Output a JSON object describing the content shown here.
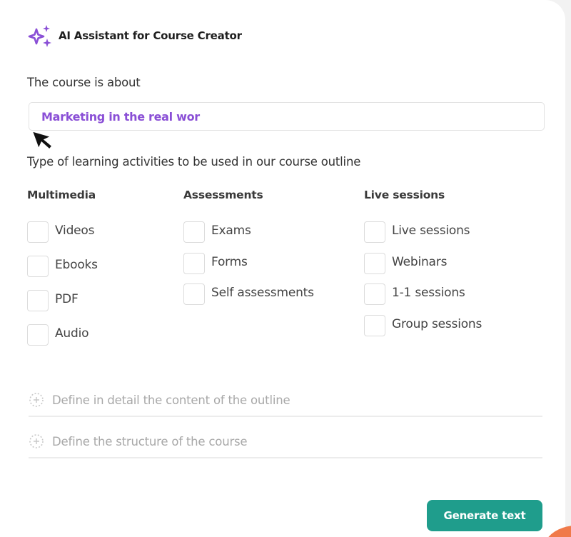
{
  "header": {
    "icon": "sparkles-icon",
    "title": "AI Assistant for Course Creator",
    "accent_color": "#8a4fd6"
  },
  "topic": {
    "label": "The course is about",
    "value": "Marketing in the real wor"
  },
  "activities": {
    "label": "Type of learning activities to be used in our course outline",
    "groups": [
      {
        "title": "Multimedia",
        "options": [
          {
            "label": "Videos",
            "checked": false
          },
          {
            "label": "Ebooks",
            "checked": false
          },
          {
            "label": "PDF",
            "checked": false
          },
          {
            "label": "Audio",
            "checked": false
          }
        ]
      },
      {
        "title": "Assessments",
        "options": [
          {
            "label": "Exams",
            "checked": false
          },
          {
            "label": "Forms",
            "checked": false
          },
          {
            "label": "Self assessments",
            "checked": false
          }
        ]
      },
      {
        "title": "Live sessions",
        "options": [
          {
            "label": "Live sessions",
            "checked": false
          },
          {
            "label": "Webinars",
            "checked": false
          },
          {
            "label": "1-1 sessions",
            "checked": false
          },
          {
            "label": "Group sessions",
            "checked": false
          }
        ]
      }
    ]
  },
  "sections": [
    {
      "icon": "add-circle-icon",
      "label": "Define in detail the content of the outline"
    },
    {
      "icon": "add-circle-icon",
      "label": "Define the structure of the course"
    }
  ],
  "footer": {
    "generate_label": "Generate text",
    "button_color": "#1f9d8c"
  }
}
